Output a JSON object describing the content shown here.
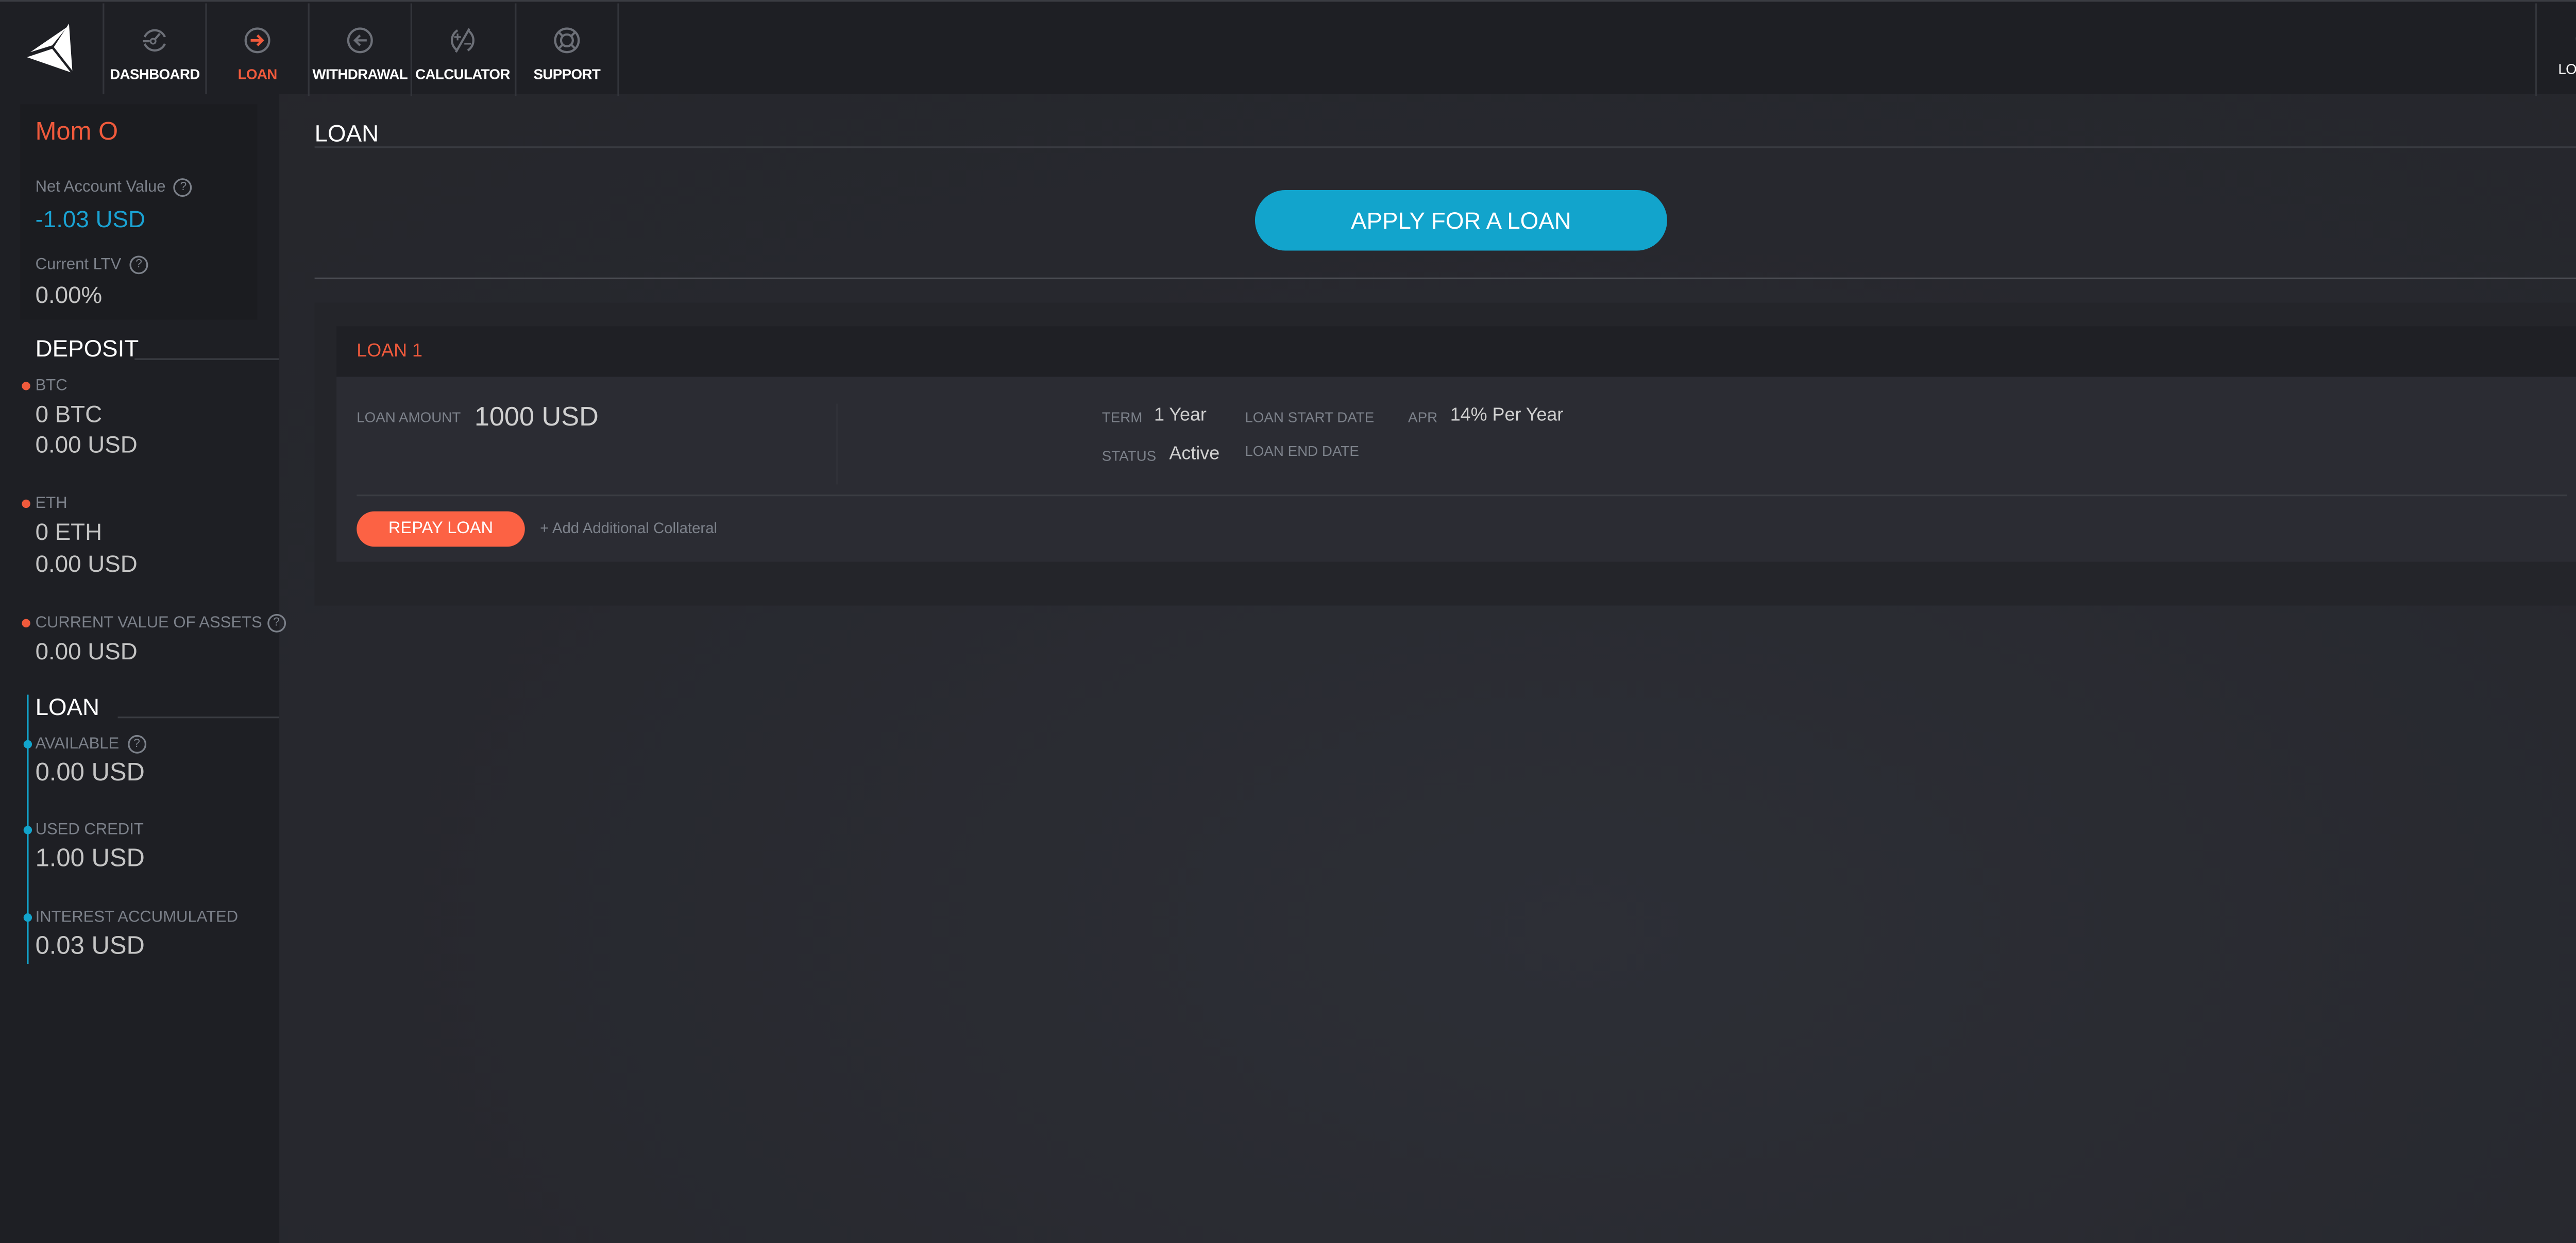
{
  "nav": {
    "items": [
      {
        "label": "DASHBOARD",
        "icon": "dashboard-gauge-icon",
        "active": false
      },
      {
        "label": "LOAN",
        "icon": "arrow-right-circle-icon",
        "active": true
      },
      {
        "label": "WITHDRAWAL",
        "icon": "arrow-left-circle-icon",
        "active": false
      },
      {
        "label": "CALCULATOR",
        "icon": "calculator-icon",
        "active": false
      },
      {
        "label": "SUPPORT",
        "icon": "lifebuoy-icon",
        "active": false
      }
    ],
    "logout_label": "LOGOUT"
  },
  "colors": {
    "accent_orange": "#f05a3c",
    "accent_blue": "#12a4cc",
    "logout_arrow": "#d9231d"
  },
  "sidebar": {
    "user_name": "Mom O",
    "net_account_value_label": "Net Account Value",
    "net_account_value": "-1.03 USD",
    "current_ltv_label": "Current LTV",
    "current_ltv": "0.00%",
    "deposit_heading": "DEPOSIT",
    "btc_label": "BTC",
    "btc_amount": "0 BTC",
    "btc_usd": "0.00 USD",
    "eth_label": "ETH",
    "eth_amount": "0 ETH",
    "eth_usd": "0.00 USD",
    "assets_label": "CURRENT VALUE OF ASSETS",
    "assets_value": "0.00 USD",
    "loan_heading": "LOAN",
    "available_label": "AVAILABLE",
    "available_value": "0.00 USD",
    "used_credit_label": "USED CREDIT",
    "used_credit_value": "1.00 USD",
    "interest_label": "INTEREST ACCUMULATED",
    "interest_value": "0.03 USD",
    "help_glyph": "?"
  },
  "main": {
    "title": "LOAN",
    "apply_button": "APPLY FOR A LOAN",
    "loan": {
      "title": "LOAN 1",
      "amount_label": "LOAN AMOUNT",
      "amount": "1000 USD",
      "term_label": "TERM",
      "term": "1 Year",
      "status_label": "STATUS",
      "status": "Active",
      "start_date_label": "LOAN START DATE",
      "end_date_label": "LOAN END DATE",
      "apr_label": "APR",
      "apr": "14% Per Year",
      "repay_button": "REPAY LOAN",
      "add_collateral_link": "+ Add Additional Collateral"
    }
  }
}
